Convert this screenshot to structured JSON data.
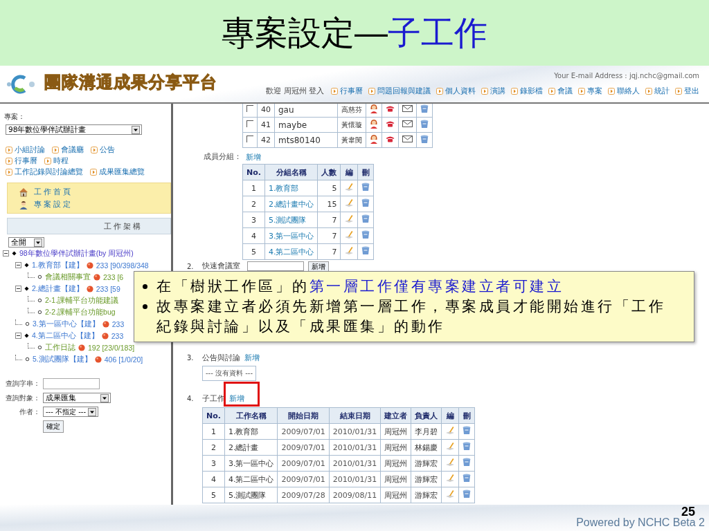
{
  "slide": {
    "title": {
      "text": "專案設定—",
      "emphasis": "子工作"
    },
    "page_number": "25",
    "footer": "Powered by NCHC Beta 2"
  },
  "header": {
    "site_title": "團隊溝通成果分享平台",
    "email": "Your E-mail Address : jqj.nchc@gmail.com",
    "welcome": "歡迎 周冠州 登入",
    "nav": [
      "行事曆",
      "問題回報與建議",
      "個人資料",
      "演講",
      "錄影檔",
      "會議",
      "專案",
      "聯絡人",
      "統計",
      "登出"
    ]
  },
  "sidebar": {
    "project_label": "專案：",
    "project": "98年數位學伴試辦計畫",
    "links": [
      [
        "小組討論",
        "會議廳",
        "公告"
      ],
      [
        "行事曆",
        "時程"
      ],
      [
        "工作記錄與討論總覽",
        "成果匯集總覽"
      ]
    ],
    "menu": [
      {
        "kind": "home",
        "label": "工作首頁"
      },
      {
        "kind": "settings",
        "label": "專案設定"
      }
    ],
    "tree_title": "工作架構",
    "expand_select": "全開",
    "tree": [
      {
        "label": "98年數位學伴試辦計畫(by 周冠州)",
        "expanded": true,
        "children": [
          {
            "label": "1.教育部【建】",
            "count": "233 [90/398/348",
            "expanded": true,
            "children": [
              {
                "label": "會議相關事宜",
                "count": "233 [6"
              }
            ]
          },
          {
            "label": "2.總計畫【建】",
            "count": "233 [59",
            "expanded": true,
            "children": [
              {
                "label": "2-1.課輔平台功能建議"
              },
              {
                "label": "2-2.課輔平台功能bug"
              }
            ]
          },
          {
            "label": "3.第一區中心【建】",
            "count": "233"
          },
          {
            "label": "4.第二區中心【建】",
            "count": "233",
            "expanded": true,
            "children": [
              {
                "label": "工作日誌",
                "count": "192 [23/0/183]"
              }
            ]
          },
          {
            "label": "5.測試團隊【建】",
            "count": "406 [1/0/20]"
          }
        ]
      }
    ],
    "search": {
      "query_label": "查詢字串：",
      "target_label": "查詢對象：",
      "target": "成果匯集",
      "author_label": "作者：",
      "author": "--- 不指定 ---",
      "submit": "確定"
    }
  },
  "members": {
    "rows": [
      {
        "checked": false,
        "no": "40",
        "account": "gau",
        "name": "高慈芬"
      },
      {
        "checked": false,
        "no": "41",
        "account": "maybe",
        "name": "黃懷璇"
      },
      {
        "checked": false,
        "no": "42",
        "account": "mts80140",
        "name": "黃韋閔"
      }
    ]
  },
  "groups": {
    "label": "成員分組：",
    "add": "新增",
    "columns": [
      "No.",
      "分組名稱",
      "人數",
      "編",
      "刪"
    ],
    "rows": [
      {
        "no": "1",
        "name": "1.教育部",
        "count": "5"
      },
      {
        "no": "2",
        "name": "2.總計畫中心",
        "count": "15"
      },
      {
        "no": "3",
        "name": "5.測試團隊",
        "count": "7"
      },
      {
        "no": "4",
        "name": "3.第一區中心",
        "count": "7"
      },
      {
        "no": "5",
        "name": "4.第二區中心",
        "count": "7"
      }
    ]
  },
  "meeting": {
    "number": "2.",
    "label": "快速會議室",
    "button": "新增"
  },
  "announcements": {
    "number": "3.",
    "label": "公告與討論",
    "add": "新增",
    "empty": "--- 沒有資料 ---"
  },
  "subtasks": {
    "number": "4.",
    "label": "子工作",
    "add": "新增",
    "columns": [
      "No.",
      "工作名稱",
      "開始日期",
      "結束日期",
      "建立者",
      "負責人",
      "編",
      "刪"
    ],
    "rows": [
      {
        "no": "1",
        "name": "1.教育部",
        "start": "2009/07/01",
        "end": "2010/01/31",
        "creator": "周冠州",
        "owner": "李月碧"
      },
      {
        "no": "2",
        "name": "2.總計畫",
        "start": "2009/07/01",
        "end": "2010/01/31",
        "creator": "周冠州",
        "owner": "林錫慶"
      },
      {
        "no": "3",
        "name": "3.第一區中心",
        "start": "2009/07/01",
        "end": "2010/01/31",
        "creator": "周冠州",
        "owner": "游輝宏"
      },
      {
        "no": "4",
        "name": "4.第二區中心",
        "start": "2009/07/01",
        "end": "2010/01/31",
        "creator": "周冠州",
        "owner": "游輝宏"
      },
      {
        "no": "5",
        "name": "5.測試團隊",
        "start": "2009/07/28",
        "end": "2009/08/11",
        "creator": "周冠州",
        "owner": "游輝宏"
      }
    ]
  },
  "callout": {
    "bullets": [
      {
        "text": "在「樹狀工作區」的",
        "emphasis": "第一層工作僅有專案建立者可建立"
      },
      {
        "text": "故專案建立者必須先新增第一層工作，專案成員才能開始進行「工作紀錄與討論」以及「成果匯集」的動作"
      }
    ]
  }
}
